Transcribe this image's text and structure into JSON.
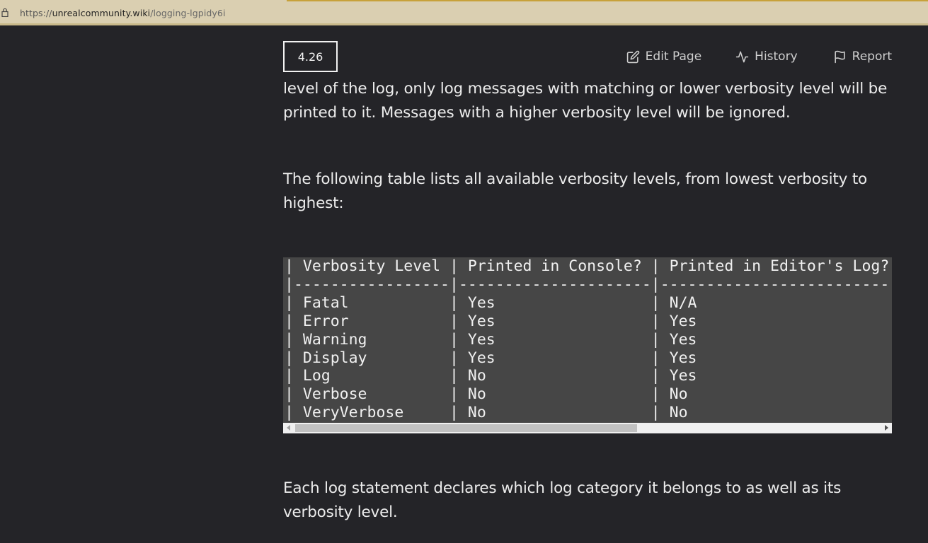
{
  "browser": {
    "url_scheme": "https://",
    "url_domain": "unrealcommunity.wiki",
    "url_path": "/logging-lgpidy6i"
  },
  "toolbar": {
    "version": "4.26",
    "edit_label": "Edit Page",
    "history_label": "History",
    "report_label": "Report"
  },
  "content": {
    "para1_line1": "level of the log, only log messages with matching or lower verbosity level will be",
    "para1_line2": "printed to it. Messages with a higher verbosity level will be ignored.",
    "para2_line1": "The following table lists all available verbosity levels, from lowest verbosity to",
    "para2_line2": "highest:",
    "para3_line1": "Each log statement declares which log category it belongs to as well as its",
    "para3_line2": "verbosity level."
  },
  "code_table": {
    "lines": [
      "| Verbosity Level | Printed in Console? | Printed in Editor's Log? | ",
      "|-----------------|---------------------|--------------------------|--",
      "| Fatal           | Yes                 | N/A                      | C",
      "| Error           | Yes                 | Yes                      | L",
      "| Warning         | Yes                 | Yes                      | L",
      "| Display         | Yes                 | Yes                      | L",
      "| Log             | No                  | Yes                      | L",
      "| Verbose         | No                  | No                       | ",
      "| VeryVerbose     | No                  | No                       | "
    ]
  }
}
